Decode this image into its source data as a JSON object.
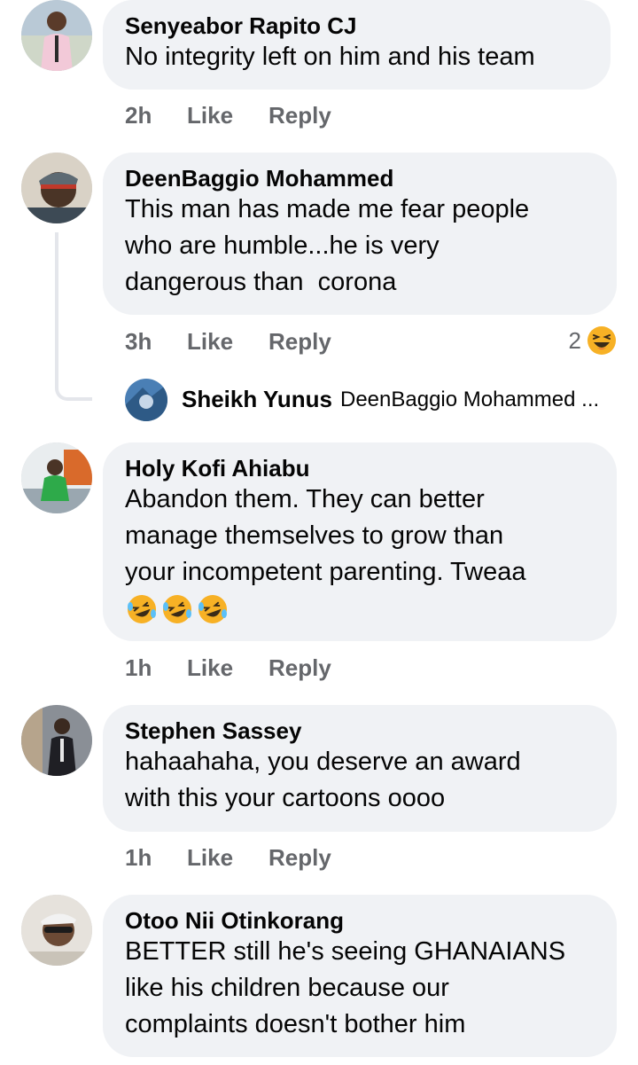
{
  "comments": [
    {
      "author": "Senyeabor Rapito CJ",
      "lines": [
        "No integrity left on him and his team"
      ],
      "time": "2h",
      "like": "Like",
      "reply": "Reply"
    },
    {
      "author": "DeenBaggio Mohammed",
      "lines": [
        "This man has made me fear people",
        "who are humble...he is very",
        "dangerous than  corona"
      ],
      "time": "3h",
      "like": "Like",
      "reply": "Reply",
      "reaction_count": "2",
      "reaction_icon": "laughing-emoji-icon",
      "reply_preview": {
        "author": "Sheikh Yunus",
        "snippet": "DeenBaggio Mohammed ..."
      }
    },
    {
      "author": "Holy Kofi Ahiabu",
      "lines": [
        "Abandon them. They can better",
        "manage themselves to grow than",
        "your incompetent parenting. Tweaa"
      ],
      "emojis": [
        "rofl-emoji-icon",
        "rofl-emoji-icon",
        "rofl-emoji-icon"
      ],
      "time": "1h",
      "like": "Like",
      "reply": "Reply"
    },
    {
      "author": "Stephen Sassey",
      "lines": [
        "hahaahaha, you deserve an award",
        "with this your cartoons oooo"
      ],
      "time": "1h",
      "like": "Like",
      "reply": "Reply"
    },
    {
      "author": "Otoo Nii Otinkorang",
      "lines": [
        "BETTER still he's seeing GHANAIANS",
        "like his children because our",
        "complaints doesn't bother him"
      ]
    }
  ],
  "colors": {
    "bubble": "#f0f2f5",
    "meta_text": "#65676b",
    "thread_line": "#e4e6eb",
    "emoji_yellow": "#f7b125"
  }
}
